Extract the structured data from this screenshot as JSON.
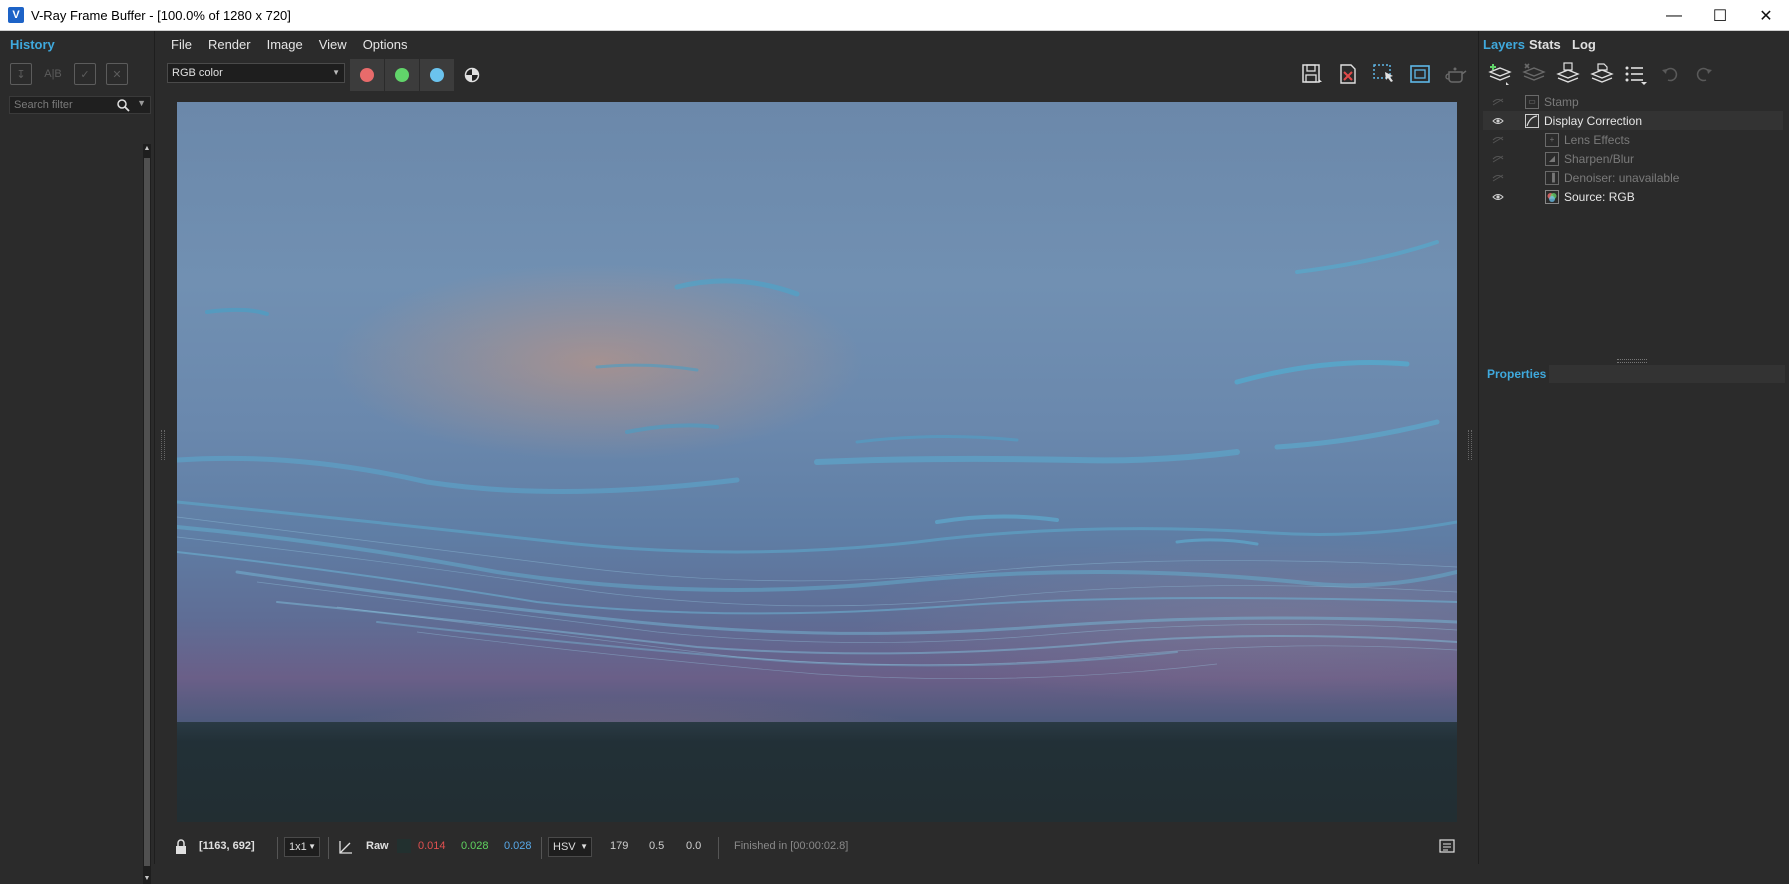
{
  "window": {
    "title": "V-Ray Frame Buffer - [100.0% of 1280 x 720]",
    "icon_letter": "V",
    "controls": {
      "minimize": "—",
      "maximize": "☐",
      "close": "✕"
    }
  },
  "history": {
    "tab": "History",
    "search_placeholder": "Search filter",
    "toolbar_icons": [
      "save-history-icon",
      "compare-ab-icon",
      "load-history-icon",
      "clear-history-icon"
    ]
  },
  "menubar": [
    "File",
    "Render",
    "Image",
    "View",
    "Options"
  ],
  "toolbar": {
    "channel": "RGB color",
    "channel_buttons": [
      {
        "name": "red-channel",
        "color": "#e86b6b"
      },
      {
        "name": "green-channel",
        "color": "#61d46a"
      },
      {
        "name": "blue-channel",
        "color": "#6bc3ee"
      }
    ]
  },
  "statusbar": {
    "coords": "[1163, 692]",
    "sampling": "1x1",
    "mode": "Raw",
    "r": "0.014",
    "g": "0.028",
    "b": "0.028",
    "colorspace": "HSV",
    "h": "179",
    "s": "0.5",
    "v": "0.0",
    "status": "Finished in [00:00:02.8]",
    "colors": {
      "r": "#e05050",
      "g": "#5fd35f",
      "b": "#57a8e8"
    }
  },
  "rightpanel": {
    "tabs": [
      "Layers",
      "Stats",
      "Log"
    ],
    "layers": [
      {
        "name": "Stamp",
        "visible": false,
        "indent": 0
      },
      {
        "name": "Display Correction",
        "visible": true,
        "indent": 0
      },
      {
        "name": "Lens Effects",
        "visible": false,
        "indent": 1
      },
      {
        "name": "Sharpen/Blur",
        "visible": false,
        "indent": 1
      },
      {
        "name": "Denoiser: unavailable",
        "visible": false,
        "indent": 1
      },
      {
        "name": "Source: RGB",
        "visible": true,
        "indent": 1
      }
    ],
    "properties_label": "Properties"
  },
  "accent_color": "#3fa9dd"
}
